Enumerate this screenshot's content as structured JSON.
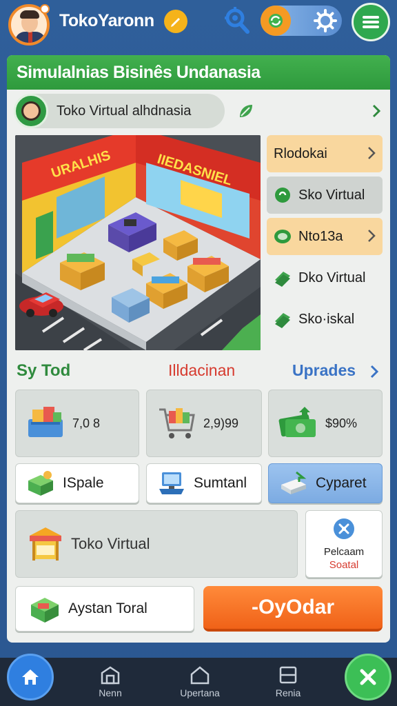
{
  "header": {
    "player_name": "TokoYaronn",
    "avatar": "businessman-avatar",
    "icons": [
      "pencil-icon",
      "search-gear-icon",
      "toggle-switch",
      "gear-icon",
      "menu-icon"
    ]
  },
  "panel": {
    "title": "Simulalnias Bisinês Undanasia",
    "store_name": "Toko Virtual alhdnasia",
    "scene_sign_left": "URALHIS",
    "scene_sign_right": "IIEDASNIEL"
  },
  "side_menu": [
    {
      "label": "Rlodokai",
      "style": "orange",
      "icon": "none",
      "chevron": true
    },
    {
      "label": "Sko Virtual",
      "style": "gray",
      "icon": "green-circle-icon",
      "chevron": false
    },
    {
      "label": "Nto13a",
      "style": "orange",
      "icon": "green-cash-icon",
      "chevron": true
    },
    {
      "label": "Dko Virtual",
      "style": "plain",
      "icon": "green-money-icon",
      "chevron": false
    },
    {
      "label": "Sko·iskal",
      "style": "plain",
      "icon": "green-money-icon",
      "chevron": false
    }
  ],
  "sections": {
    "left": "Sy Tod",
    "middle": "Illdacinan",
    "right": "Uprades"
  },
  "stats": [
    {
      "value": "7,0 8",
      "icon": "cart-boxes-icon"
    },
    {
      "value": "2,9)99",
      "icon": "shopping-cart-icon"
    },
    {
      "value": "$90%",
      "icon": "cash-stack-icon"
    }
  ],
  "actions": [
    {
      "label": "ISpale",
      "icon": "green-box-icon"
    },
    {
      "label": "Sumtanl",
      "icon": "computer-icon"
    },
    {
      "label": "Cyparet",
      "icon": "package-icon"
    }
  ],
  "store_card": {
    "label": "Toko Virtual",
    "icon": "market-stall-icon"
  },
  "settings_card": {
    "line1": "Pelcaam",
    "line2": "Soatal",
    "icon": "tools-icon"
  },
  "total_card": {
    "label": "Aystan Toral",
    "icon": "green-crate-icon"
  },
  "order_button": {
    "label": "-OyOdar"
  },
  "bottom_nav": [
    {
      "label": "Nenn",
      "icon": "store-icon"
    },
    {
      "label": "Upertana",
      "icon": "house-icon"
    },
    {
      "label": "Renia",
      "icon": "tray-icon"
    }
  ],
  "colors": {
    "background": "#2f5f9a",
    "header_green": "#42b04e",
    "order_orange": "#f06218",
    "upgrades_blue": "#3a73c5",
    "accent_red": "#d63a2e"
  }
}
